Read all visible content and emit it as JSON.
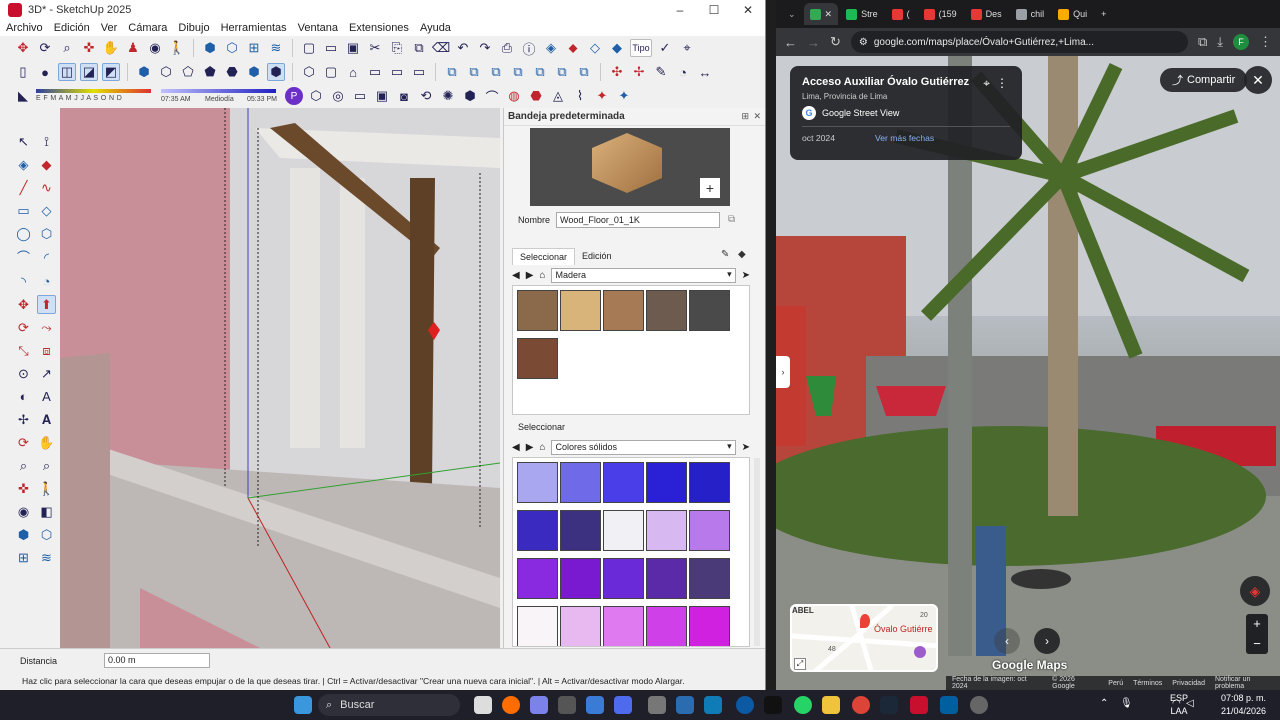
{
  "sketchup": {
    "title": "3D* - SketchUp 2025",
    "menu": [
      "Archivo",
      "Edición",
      "Ver",
      "Cámara",
      "Dibujo",
      "Herramientas",
      "Ventana",
      "Extensiones",
      "Ayuda"
    ],
    "shadow_time_start": "07:35 AM",
    "shadow_time_mid": "Mediodía",
    "shadow_time_end": "05:33 PM",
    "shadow_months": "E F M A M J J A S O N D",
    "tipo_label": "Tipo",
    "tray": {
      "title": "Bandeja predeterminada",
      "name_label": "Nombre",
      "name_value": "Wood_Floor_01_1K",
      "tab_select": "Seleccionar",
      "tab_edit": "Edición",
      "library1": "Madera",
      "select_header2": "Seleccionar",
      "library2": "Colores sólidos",
      "wood_swatches": [
        "#8a6a4a",
        "#d9b47a",
        "#a57a55",
        "#6d5b50",
        "#4a4a4a",
        "#7a4a35"
      ],
      "solid_swatches": [
        "#a9a7f0",
        "#6f6be8",
        "#4a3ee8",
        "#2a21d6",
        "#2620c8",
        "#3a2ac0",
        "#3c3080",
        "#f0f0f5",
        "#d8b8f0",
        "#b87aea",
        "#8a2ae0",
        "#7a1ad0",
        "#6a2ad8",
        "#5a2aa8",
        "#4a3a78",
        "#f8f4f8",
        "#e8b8f0",
        "#e07af0",
        "#d040e8",
        "#d020e0"
      ]
    },
    "status": {
      "distance_label": "Distancia",
      "distance_value": "0.00 m",
      "hint": "Haz clic para seleccionar la cara que deseas empujar o de la que deseas tirar. | Ctrl = Activar/desactivar \"Crear una nueva cara inicial\". | Alt = Activar/desactivar modo Alargar."
    }
  },
  "chrome": {
    "tabs": [
      {
        "label": "Stre",
        "color": "#1db954"
      },
      {
        "label": "(",
        "color": "#e53935"
      },
      {
        "label": "(159",
        "color": "#e53935"
      },
      {
        "label": "Des",
        "color": "#e53935"
      },
      {
        "label": "chil",
        "color": "#9aa0a6"
      },
      {
        "label": "Qui",
        "color": "#f9ab00"
      }
    ],
    "url": "google.com/maps/place/Óvalo+Gutiérrez,+Lima...",
    "place_title": "Acceso Auxiliar Óvalo Gutiérrez",
    "place_subtitle": "Lima, Provincia de Lima",
    "source": "Google Street View",
    "date": "oct 2024",
    "more_dates": "Ver más fechas",
    "share": "Compartir",
    "minimap_label": "Óvalo Gutiérre",
    "minimap_road1": "ABEL",
    "minimap_num1": "20",
    "minimap_num2": "48",
    "watermark": "Google Maps",
    "footer": [
      "Fecha de la imagen: oct 2024",
      "© 2026 Google",
      "Perú",
      "Términos",
      "Privacidad",
      "Notificar un problema"
    ]
  },
  "taskbar": {
    "search": "Buscar",
    "lang_top": "ESP",
    "lang_bottom": "LAA",
    "time": "07:08 p. m.",
    "date": "21/04/2026"
  }
}
